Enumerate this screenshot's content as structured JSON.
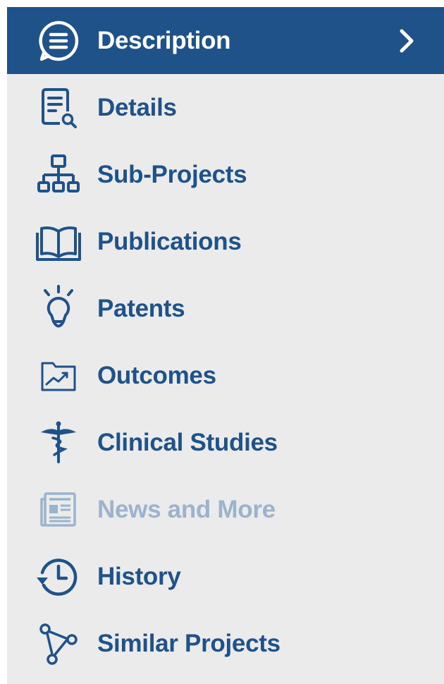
{
  "colors": {
    "active_bg": "#1e5289",
    "active_text": "#ffffff",
    "item_text": "#1e5289",
    "disabled_text": "#9bb3cd",
    "sidebar_bg": "#ebebeb"
  },
  "nav": {
    "items": [
      {
        "label": "Description",
        "icon": "speech-bubble-list-icon",
        "active": true
      },
      {
        "label": "Details",
        "icon": "document-search-icon"
      },
      {
        "label": "Sub-Projects",
        "icon": "org-chart-icon"
      },
      {
        "label": "Publications",
        "icon": "open-book-icon"
      },
      {
        "label": "Patents",
        "icon": "lightbulb-icon"
      },
      {
        "label": "Outcomes",
        "icon": "folder-chart-icon"
      },
      {
        "label": "Clinical Studies",
        "icon": "caduceus-icon"
      },
      {
        "label": "News and More",
        "icon": "newspaper-icon",
        "disabled": true
      },
      {
        "label": "History",
        "icon": "history-clock-icon"
      },
      {
        "label": "Similar Projects",
        "icon": "network-nodes-icon"
      }
    ],
    "active_chevron": "chevron-right-icon"
  }
}
